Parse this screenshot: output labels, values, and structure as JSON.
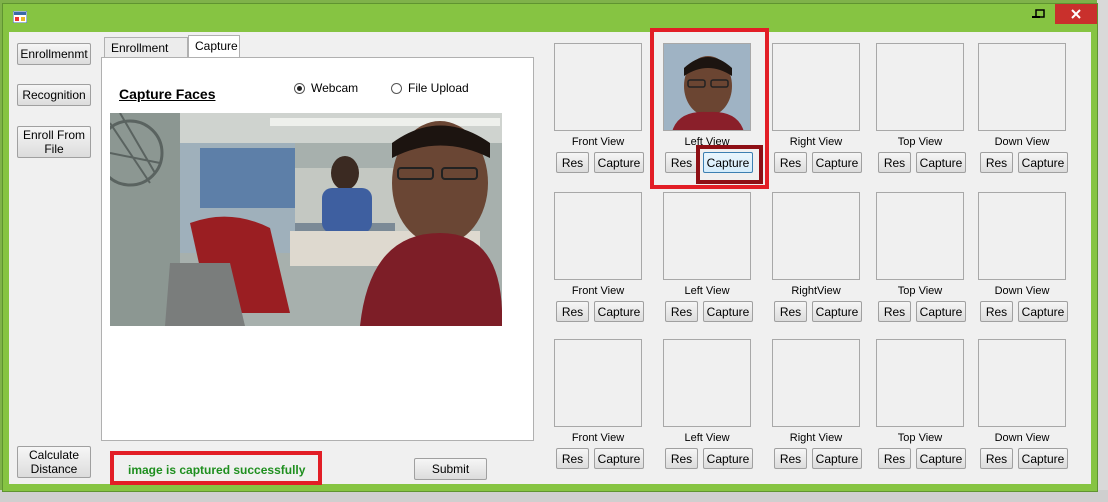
{
  "left_nav": {
    "enrollment": "Enrollmenmt",
    "recognition": "Recognition",
    "enroll_from_file": "Enroll From File",
    "calculate_distance": "Calculate Distance"
  },
  "tabs": [
    "Enrollment Form",
    "Capture"
  ],
  "capture": {
    "title": "Capture Faces",
    "source_options": [
      "Webcam",
      "File Upload"
    ],
    "selected_source": "Webcam",
    "status": "image is captured successfully",
    "submit": "Submit"
  },
  "grid": {
    "rows": [
      [
        "Front View",
        "Left View",
        "Right View",
        "Top View",
        "Down View"
      ],
      [
        "Front View",
        "Left View",
        "RightView",
        "Top View",
        "Down View"
      ],
      [
        "Front View",
        "Left View",
        "Right View",
        "Top View",
        "Down View"
      ]
    ],
    "res_label": "Res",
    "capture_label": "Capture"
  },
  "colors": {
    "highlight": "#e21e26",
    "status": "#1f8f1f",
    "titlebar": "#86c442"
  }
}
